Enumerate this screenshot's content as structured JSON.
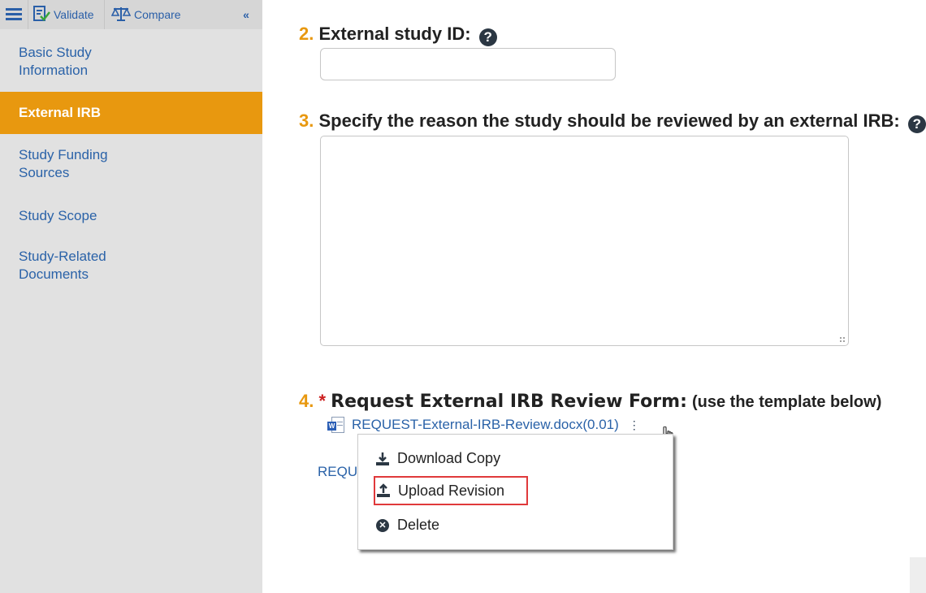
{
  "toolbar": {
    "menu_icon": "hamburger-icon",
    "validate_label": "Validate",
    "compare_label": "Compare",
    "collapse_icon": "double-chevron-left-icon"
  },
  "sidebar": {
    "items": [
      {
        "label_line1": "Basic Study",
        "label_line2": "Information"
      },
      {
        "label": "External IRB",
        "active": true
      },
      {
        "label_line1": "Study Funding",
        "label_line2": "Sources"
      },
      {
        "label": "Study Scope"
      },
      {
        "label_line1": "Study-Related",
        "label_line2": "Documents"
      }
    ]
  },
  "form": {
    "q2": {
      "number": "2.",
      "label": "External study ID:",
      "value": ""
    },
    "q3": {
      "number": "3.",
      "label": "Specify the reason the study should be reviewed by an external IRB:",
      "value": ""
    },
    "q4": {
      "number": "4.",
      "required": "*",
      "label": "Request External IRB Review Form:",
      "hint": "(use the template below)"
    }
  },
  "attachment": {
    "filename": "REQUEST-External-IRB-Review.docx(0.01)",
    "partial_link": "REQU"
  },
  "context_menu": {
    "items": [
      {
        "label": "Download Copy",
        "icon": "download-icon"
      },
      {
        "label": "Upload Revision",
        "icon": "upload-icon",
        "highlighted": true
      },
      {
        "label": "Delete",
        "icon": "delete-circle-icon"
      }
    ]
  },
  "colors": {
    "accent": "#e8980f",
    "link": "#2a62a8",
    "required": "#cc1f1f",
    "highlight_border": "#e0393b"
  }
}
